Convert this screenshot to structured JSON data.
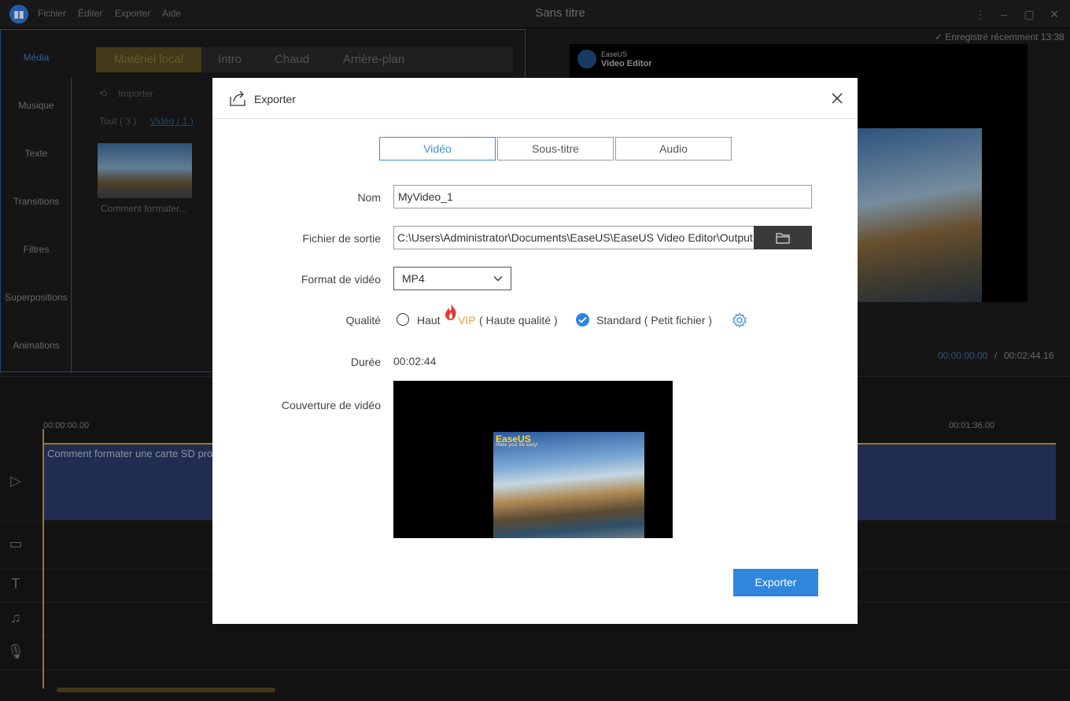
{
  "app": {
    "window_title": "Sans titre",
    "menu": [
      "Fichier",
      "Éditer",
      "Exporter",
      "Aide"
    ]
  },
  "sidebar": {
    "items": [
      {
        "label": "Média"
      },
      {
        "label": "Musique"
      },
      {
        "label": "Texte"
      },
      {
        "label": "Transitions"
      },
      {
        "label": "Filtres"
      },
      {
        "label": "Superpositions"
      },
      {
        "label": "Animations"
      }
    ]
  },
  "media_panel": {
    "tabs": [
      "Matériel local",
      "Intro",
      "Chaud",
      "Arrière-plan"
    ],
    "import_label": "Importer",
    "filter_all": "Tout ( 3 )",
    "filter_video": "Vidéo ( 1 )",
    "item_label": "Comment formater..."
  },
  "preview": {
    "saved_status": "Enregistré récemment 13:38",
    "brand_small": "EaseUS",
    "brand_product": "Video Editor",
    "time_current": "00:00:00.00",
    "time_separator": "/",
    "time_total": "00:02:44.16"
  },
  "timeline": {
    "ruler_start": "00:00:00.00",
    "ruler_mid": "00:01:36.00",
    "clip_title": "Comment formater une carte SD pro"
  },
  "dialog": {
    "title": "Exporter",
    "tabs": {
      "video": "Vidéo",
      "subtitle": "Sous-titre",
      "audio": "Audio"
    },
    "labels": {
      "name": "Nom",
      "output": "Fichier de sortie",
      "format": "Format de vidéo",
      "quality": "Qualité",
      "duration": "Durée",
      "cover": "Couverture de vidéo"
    },
    "name_value": "MyVideo_1",
    "output_path": "C:\\Users\\Administrator\\Documents\\EaseUS\\EaseUS Video Editor\\Output",
    "format_value": "MP4",
    "quality_high": "Haut",
    "quality_vip": "VIP",
    "quality_high_desc": "( Haute qualité )",
    "quality_standard": "Standard ( Petit fichier )",
    "quality_selected": "standard",
    "duration_value": "00:02:44",
    "cover_brand": "EaseUS",
    "cover_tagline": "Make your life easy!",
    "export_button": "Exporter"
  },
  "colors": {
    "accent": "#2f86dc",
    "gold": "#c9a33a",
    "vip": "#e8a030"
  }
}
